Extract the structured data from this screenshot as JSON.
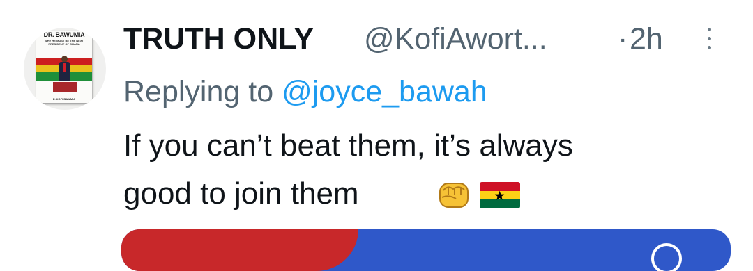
{
  "tweet": {
    "display_name": "TRUTH ONLY",
    "handle": "@KofiAwort...",
    "separator": "·",
    "time": "2h",
    "reply_prefix": "Replying to",
    "reply_mention": "@joyce_bawah",
    "text_line1": "If you can’t beat them, it’s always",
    "text_line2": "good to join them",
    "emojis": [
      "raised-fist",
      "ghana-flag"
    ]
  },
  "avatar": {
    "book_title": "DR. BAWUMIA",
    "book_subtitle": "WHY HE MUST BE THE NEXT PRESIDENT OF GHANA",
    "book_author": "E. KOFI BAWMIA"
  },
  "colors": {
    "text": "#0f1419",
    "muted": "#536471",
    "link": "#1d9bf0",
    "card_blue": "#2f58c9",
    "card_red": "#c8282a"
  },
  "icons": {
    "more": "more-vertical-icon"
  }
}
